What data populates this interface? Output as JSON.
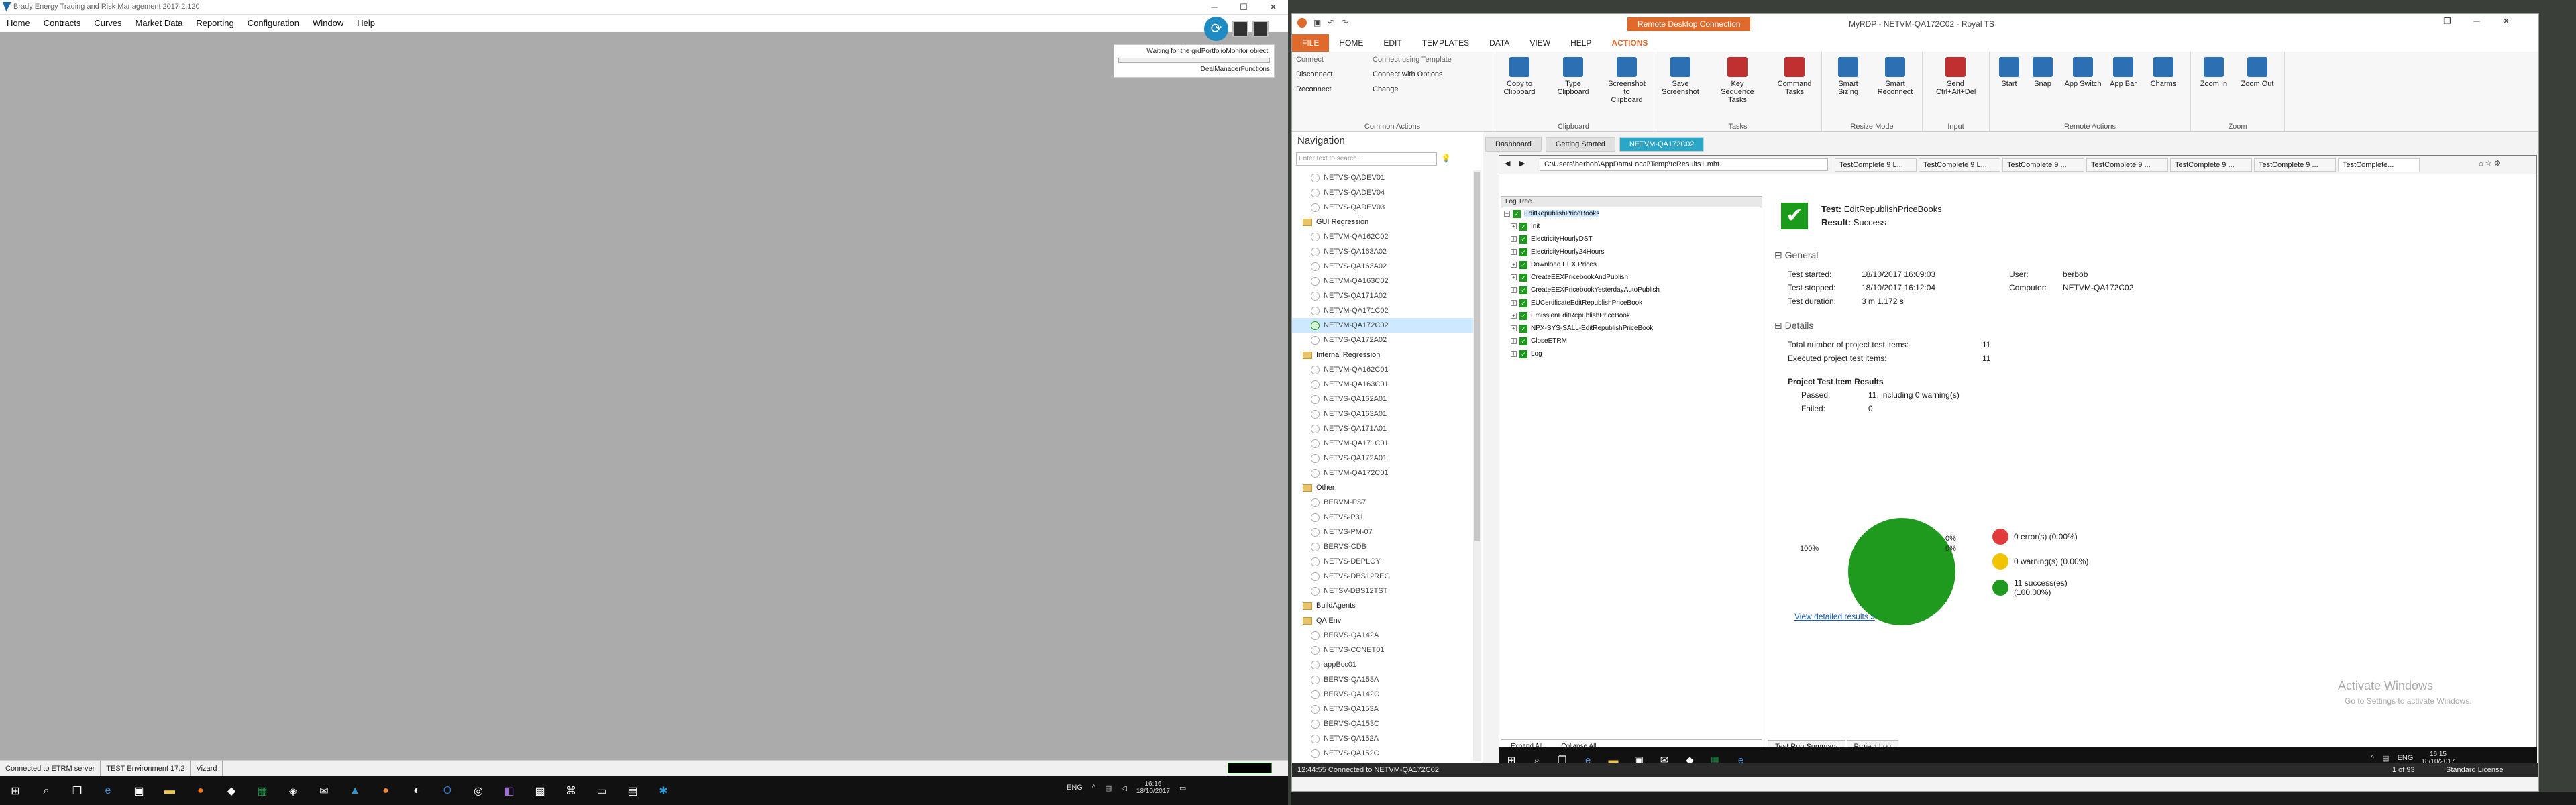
{
  "brady": {
    "title": "Brady Energy Trading and Risk Management 2017.2.120",
    "menu": [
      "Home",
      "Contracts",
      "Curves",
      "Market Data",
      "Reporting",
      "Configuration",
      "Window",
      "Help"
    ],
    "waiting_msg": "Waiting for the grdPortfolioMonitor object.",
    "waiting_sub": "DealManagerFunctions",
    "status": [
      "Connected to ETRM server",
      "TEST Environment 17.2",
      "Vizard"
    ]
  },
  "left_taskbar": {
    "lang": "ENG",
    "time": "16:16",
    "date": "18/10/2017"
  },
  "rts": {
    "title": "MyRDP - NETVM-QA172C02 - Royal TS",
    "context_label": "Remote Desktop Connection",
    "tabs": [
      "FILE",
      "HOME",
      "EDIT",
      "TEMPLATES",
      "DATA",
      "VIEW",
      "HELP",
      "ACTIONS"
    ],
    "ribbon": {
      "common": {
        "small": [
          "Connect",
          "Disconnect",
          "Reconnect",
          "Connect using Template",
          "Connect with Options",
          "Change"
        ],
        "label": "Common Actions"
      },
      "clipboard": {
        "buttons": [
          "Copy to Clipboard",
          "Type Clipboard",
          "Screenshot to Clipboard"
        ],
        "label": "Clipboard"
      },
      "tasks": {
        "buttons": [
          "Save Screenshot",
          "Key Sequence Tasks",
          "Command Tasks"
        ],
        "label": "Tasks"
      },
      "resize": {
        "buttons": [
          "Smart Sizing",
          "Smart Reconnect"
        ],
        "label": "Resize Mode"
      },
      "input": {
        "buttons": [
          "Send Ctrl+Alt+Del"
        ],
        "label": "Input"
      },
      "remote": {
        "buttons": [
          "Start",
          "Snap",
          "App Switch",
          "App Bar",
          "Charms"
        ],
        "label": "Remote Actions"
      },
      "zoom": {
        "buttons": [
          "Zoom In",
          "Zoom Out"
        ],
        "label": "Zoom"
      }
    },
    "nav": {
      "title": "Navigation",
      "search_placeholder": "Enter text to search...",
      "items": [
        {
          "type": "conn",
          "label": "NETVS-QADEV01"
        },
        {
          "type": "conn",
          "label": "NETVS-QADEV04"
        },
        {
          "type": "conn",
          "label": "NETVS-QADEV03"
        },
        {
          "type": "folder",
          "label": "GUI Regression"
        },
        {
          "type": "conn",
          "label": "NETVM-QA162C02"
        },
        {
          "type": "conn",
          "label": "NETVS-QA163A02"
        },
        {
          "type": "conn",
          "label": "NETVS-QA163A02"
        },
        {
          "type": "conn",
          "label": "NETVM-QA163C02"
        },
        {
          "type": "conn",
          "label": "NETVS-QA171A02"
        },
        {
          "type": "conn",
          "label": "NETVM-QA171C02"
        },
        {
          "type": "conn",
          "label": "NETVM-QA172C02",
          "active": true
        },
        {
          "type": "conn",
          "label": "NETVS-QA172A02"
        },
        {
          "type": "folder",
          "label": "Internal Regression"
        },
        {
          "type": "conn",
          "label": "NETVM-QA162C01"
        },
        {
          "type": "conn",
          "label": "NETVM-QA163C01"
        },
        {
          "type": "conn",
          "label": "NETVS-QA162A01"
        },
        {
          "type": "conn",
          "label": "NETVS-QA163A01"
        },
        {
          "type": "conn",
          "label": "NETVS-QA171A01"
        },
        {
          "type": "conn",
          "label": "NETVM-QA171C01"
        },
        {
          "type": "conn",
          "label": "NETVS-QA172A01"
        },
        {
          "type": "conn",
          "label": "NETVM-QA172C01"
        },
        {
          "type": "folder",
          "label": "Other"
        },
        {
          "type": "conn",
          "label": "BERVM-PS7"
        },
        {
          "type": "conn",
          "label": "NETVS-P31"
        },
        {
          "type": "conn",
          "label": "NETVS-PM-07"
        },
        {
          "type": "conn",
          "label": "BERVS-CDB"
        },
        {
          "type": "conn",
          "label": "NETVS-DEPLOY"
        },
        {
          "type": "conn",
          "label": "NETVS-DBS12REG"
        },
        {
          "type": "conn",
          "label": "NETSV-DBS12TST"
        },
        {
          "type": "folder",
          "label": "BuildAgents"
        },
        {
          "type": "folder",
          "label": "QA Env"
        },
        {
          "type": "conn",
          "label": "BERVS-QA142A"
        },
        {
          "type": "conn",
          "label": "NETVS-CCNET01"
        },
        {
          "type": "conn",
          "label": "appBcc01"
        },
        {
          "type": "conn",
          "label": "BERVS-QA153A"
        },
        {
          "type": "conn",
          "label": "BERVS-QA142C"
        },
        {
          "type": "conn",
          "label": "NETVS-QA153A"
        },
        {
          "type": "conn",
          "label": "BERVS-QA153C"
        },
        {
          "type": "conn",
          "label": "NETVS-QA152A"
        },
        {
          "type": "conn",
          "label": "NETVS-QA152C"
        }
      ]
    },
    "doc_tabs": [
      "Dashboard",
      "Getting Started",
      "NETVM-QA172C02"
    ],
    "status_left": "12:44:55 Connected to NETVM-QA172C02",
    "status_right": [
      "1 of 93",
      "Standard License"
    ]
  },
  "remote": {
    "address": "C:\\Users\\berbob\\AppData\\Local\\Temp\\tcResults1.mht",
    "ie_tabs": [
      "TestComplete 9 L...",
      "TestComplete 9 L...",
      "TestComplete 9 ...",
      "TestComplete 9 ...",
      "TestComplete 9 ...",
      "TestComplete 9 ...",
      "TestComplete..."
    ],
    "log_tree_header": "Log Tree",
    "log_items": [
      "EditRepublishPriceBooks",
      "Init",
      "ElectricityHourlyDST",
      "ElectricityHourly24Hours",
      "Download EEX Prices",
      "CreateEEXPricebookAndPublish",
      "CreateEEXPricebookYesterdayAutoPublish",
      "EUCertificateEditRepublishPriceBook",
      "EmissionEditRepublishPriceBook",
      "NPX-SYS-SALL-EditRepublishPriceBook",
      "CloseETRM",
      "Log"
    ],
    "expand_all": "Expand All",
    "collapse_all": "Collapse All",
    "test_label": "Test:",
    "test_name": "EditRepublishPriceBooks",
    "result_label": "Result:",
    "result_value": "Success",
    "general": "General",
    "general_rows": [
      {
        "k": "Test started:",
        "v": "18/10/2017 16:09:03"
      },
      {
        "k": "Test stopped:",
        "v": "18/10/2017 16:12:04"
      },
      {
        "k": "Test duration:",
        "v": "3 m 1.172 s"
      }
    ],
    "user_label": "User:",
    "user": "berbob",
    "computer_label": "Computer:",
    "computer": "NETVM-QA172C02",
    "details": "Details",
    "detail_rows": [
      {
        "k": "Total number of project test items:",
        "v": "11"
      },
      {
        "k": "Executed project test items:",
        "v": "11"
      }
    ],
    "ptr_title": "Project Test Item Results",
    "passed_label": "Passed:",
    "passed": "11, including 0 warning(s)",
    "failed_label": "Failed:",
    "failed": "0",
    "legend": [
      {
        "text": "0 error(s) (0.00%)",
        "color": "#e23a3a"
      },
      {
        "text": "0 warning(s) (0.00%)",
        "color": "#f2c300"
      },
      {
        "text": "11 success(es) (100.00%)",
        "color": "#1f9a1f"
      }
    ],
    "pie_labels": [
      "100%",
      "0%",
      "0%"
    ],
    "view_link": "View detailed results »",
    "activate1": "Activate Windows",
    "activate2": "Go to Settings to activate Windows.",
    "bottom_tabs": [
      "Test Run Summary",
      "Project Log"
    ],
    "taskbar_right": {
      "lang": "ENG",
      "time": "16:15",
      "date": "18/10/2017"
    }
  },
  "chart_data": {
    "type": "pie",
    "categories": [
      "error(s)",
      "warning(s)",
      "success(es)"
    ],
    "values": [
      0,
      0,
      11
    ],
    "colors": [
      "#e23a3a",
      "#f2c300",
      "#1f9a1f"
    ]
  }
}
